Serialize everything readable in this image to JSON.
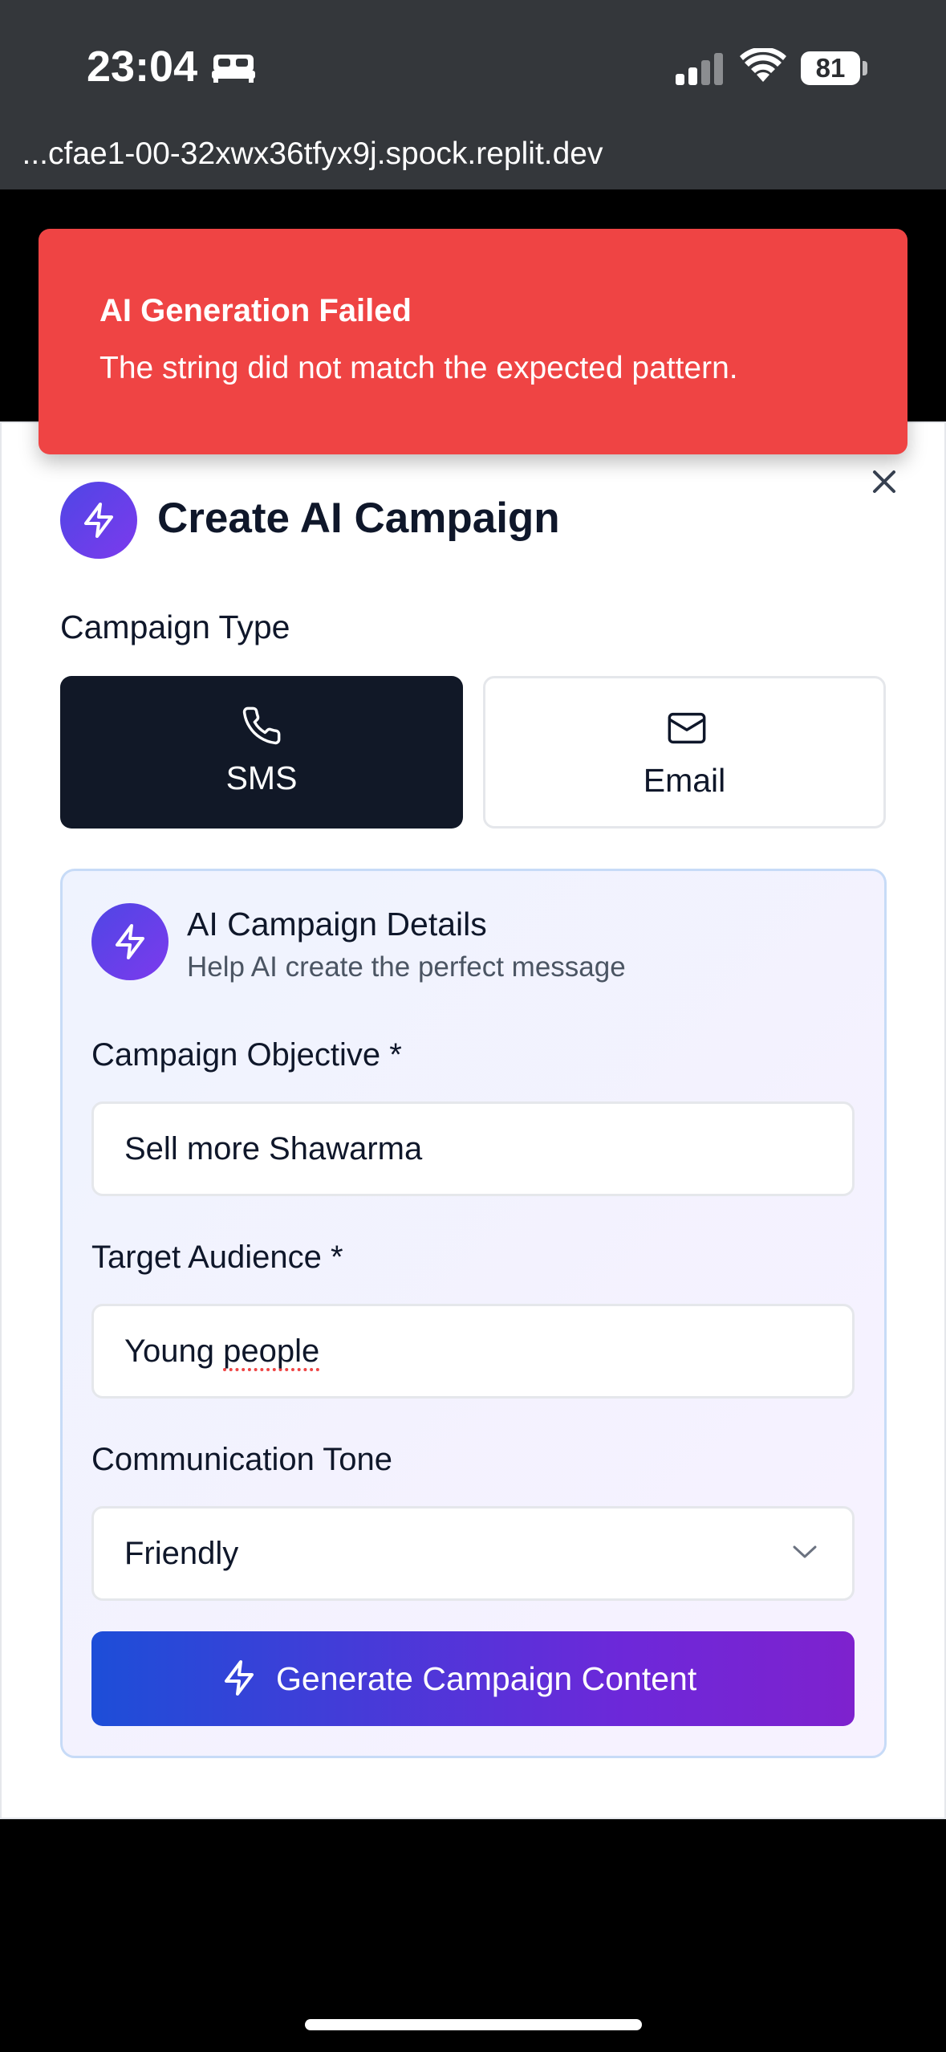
{
  "status_bar": {
    "time": "23:04",
    "battery": "81"
  },
  "browser": {
    "url": "...cfae1-00-32xwx36tfyx9j.spock.replit.dev"
  },
  "toast": {
    "title": "AI Generation Failed",
    "description": "The string did not match the expected pattern."
  },
  "dialog": {
    "title": "Create AI Campaign",
    "campaign_type_label": "Campaign Type",
    "types": [
      {
        "label": "SMS",
        "icon": "phone-icon",
        "selected": true
      },
      {
        "label": "Email",
        "icon": "mail-icon",
        "selected": false
      }
    ],
    "details": {
      "title": "AI Campaign Details",
      "subtitle": "Help AI create the perfect message",
      "objective_label": "Campaign Objective *",
      "objective_value": "Sell more Shawarma",
      "audience_label": "Target Audience *",
      "audience_value_word1": "Young",
      "audience_value_word2": "people",
      "tone_label": "Communication Tone",
      "tone_value": "Friendly",
      "generate_label": "Generate Campaign Content"
    }
  },
  "colors": {
    "toast_bg": "#ef4444",
    "selected_type_bg": "#111827",
    "gradient_start": "#1d4ed8",
    "gradient_end": "#7e22ce"
  }
}
